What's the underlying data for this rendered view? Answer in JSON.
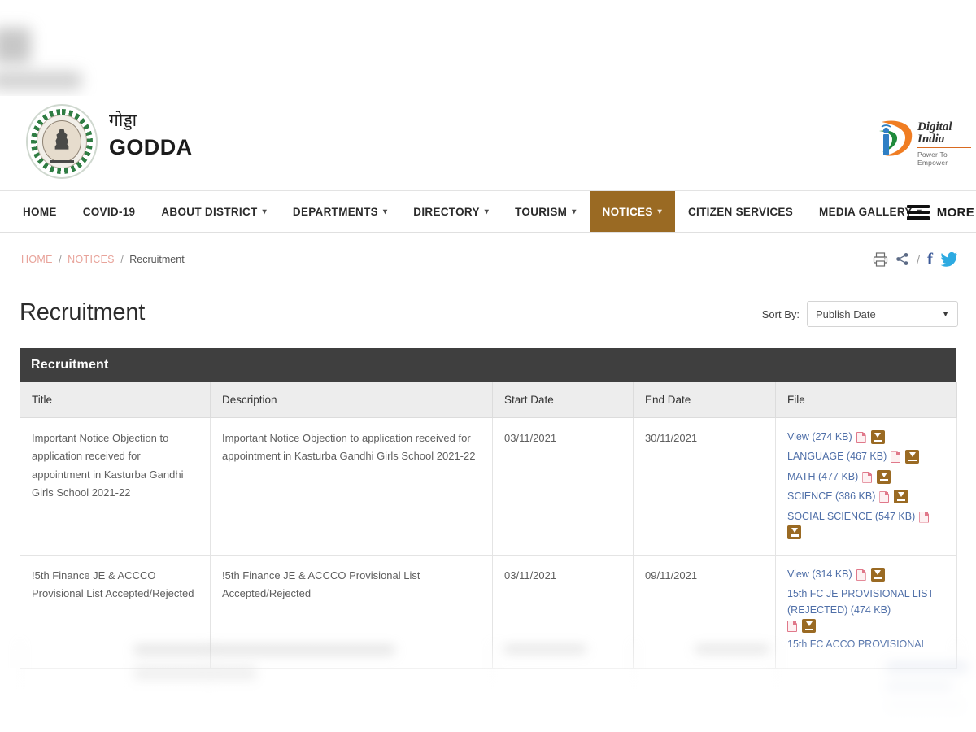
{
  "header": {
    "emblem_alt": "jharkhand-state-emblem",
    "district_name_hi": "गोड्डा",
    "district_name_en": "GODDA",
    "digital_india": {
      "title": "Digital India",
      "subtitle": "Power To Empower"
    }
  },
  "nav": {
    "items": [
      {
        "label": "HOME",
        "has_caret": false,
        "active": false
      },
      {
        "label": "COVID-19",
        "has_caret": false,
        "active": false
      },
      {
        "label": "ABOUT DISTRICT",
        "has_caret": true,
        "active": false
      },
      {
        "label": "DEPARTMENTS",
        "has_caret": true,
        "active": false
      },
      {
        "label": "DIRECTORY",
        "has_caret": true,
        "active": false
      },
      {
        "label": "TOURISM",
        "has_caret": true,
        "active": false
      },
      {
        "label": "NOTICES",
        "has_caret": true,
        "active": true
      },
      {
        "label": "CITIZEN SERVICES",
        "has_caret": false,
        "active": false
      },
      {
        "label": "MEDIA GALLERY",
        "has_caret": true,
        "active": false
      }
    ],
    "more_label": "MORE",
    "active_color": "#9a6a23"
  },
  "breadcrumb": {
    "home": "HOME",
    "notices": "NOTICES",
    "current": "Recruitment",
    "separator": "/",
    "link_color": "#e8a39a"
  },
  "share": {
    "print": "print-icon",
    "share": "share-icon",
    "slash": "/",
    "facebook": "f",
    "twitter": "twitter-icon",
    "facebook_color": "#3b5998",
    "twitter_color": "#2daae1"
  },
  "page": {
    "title": "Recruitment",
    "sort_label": "Sort By:",
    "sort_value": "Publish Date"
  },
  "table": {
    "caption": "Recruitment",
    "caption_bg": "#3f3f3f",
    "columns": [
      "Title",
      "Description",
      "Start Date",
      "End Date",
      "File"
    ],
    "rows": [
      {
        "title": "Important Notice Objection to application received for appointment in Kasturba Gandhi Girls School 2021-22",
        "description": "Important Notice Objection to application received for appointment in Kasturba Gandhi Girls School 2021-22",
        "start_date": "03/11/2021",
        "end_date": "30/11/2021",
        "files": [
          {
            "label": "View (274 KB)"
          },
          {
            "label": "LANGUAGE (467 KB)"
          },
          {
            "label": "MATH (477 KB)"
          },
          {
            "label": "SCIENCE (386 KB)"
          },
          {
            "label": "SOCIAL SCIENCE (547 KB)"
          }
        ]
      },
      {
        "title": "!5th Finance JE & ACCCO Provisional List Accepted/Rejected",
        "description": "!5th Finance JE & ACCCO Provisional List Accepted/Rejected",
        "start_date": "03/11/2021",
        "end_date": "09/11/2021",
        "files": [
          {
            "label": "View (314 KB)"
          },
          {
            "label": "15th FC JE PROVISIONAL LIST (REJECTED) (474 KB)"
          },
          {
            "label": "15th FC ACCO PROVISIONAL"
          }
        ]
      }
    ],
    "link_color": "#4f6fa8",
    "download_color": "#9a6a23"
  }
}
